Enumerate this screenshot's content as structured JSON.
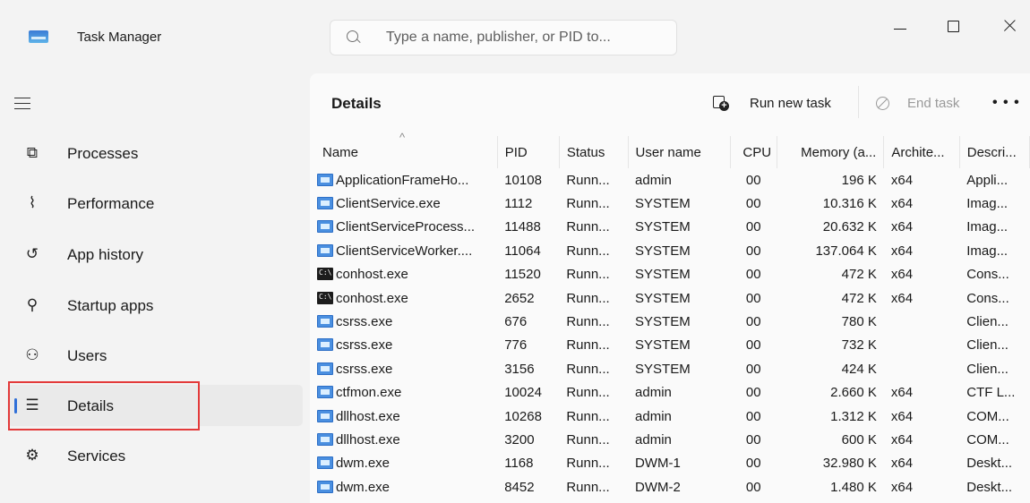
{
  "titlebar": {
    "app_title": "Task Manager",
    "search_placeholder": "Type a name, publisher, or PID to..."
  },
  "sidebar": {
    "items": [
      {
        "icon": "processes-icon",
        "label": "Processes"
      },
      {
        "icon": "performance-icon",
        "label": "Performance"
      },
      {
        "icon": "app-history-icon",
        "label": "App history"
      },
      {
        "icon": "startup-apps-icon",
        "label": "Startup apps"
      },
      {
        "icon": "users-icon",
        "label": "Users"
      },
      {
        "icon": "details-icon",
        "label": "Details",
        "selected": true
      },
      {
        "icon": "services-icon",
        "label": "Services"
      }
    ]
  },
  "main": {
    "title": "Details",
    "run_new_task": "Run new task",
    "end_task": "End task",
    "columns": [
      "Name",
      "PID",
      "Status",
      "User name",
      "CPU",
      "Memory (a...",
      "Archite...",
      "Descri..."
    ],
    "rows": [
      {
        "icon": "window",
        "name": "ApplicationFrameHo...",
        "pid": "10108",
        "status": "Runn...",
        "user": "admin",
        "cpu": "00",
        "mem": "196 K",
        "arch": "x64",
        "desc": "Appli..."
      },
      {
        "icon": "window",
        "name": "ClientService.exe",
        "pid": "1112",
        "status": "Runn...",
        "user": "SYSTEM",
        "cpu": "00",
        "mem": "10.316 K",
        "arch": "x64",
        "desc": "Imag..."
      },
      {
        "icon": "window",
        "name": "ClientServiceProcess...",
        "pid": "11488",
        "status": "Runn...",
        "user": "SYSTEM",
        "cpu": "00",
        "mem": "20.632 K",
        "arch": "x64",
        "desc": "Imag..."
      },
      {
        "icon": "window",
        "name": "ClientServiceWorker....",
        "pid": "11064",
        "status": "Runn...",
        "user": "SYSTEM",
        "cpu": "00",
        "mem": "137.064 K",
        "arch": "x64",
        "desc": "Imag..."
      },
      {
        "icon": "console",
        "name": "conhost.exe",
        "pid": "11520",
        "status": "Runn...",
        "user": "SYSTEM",
        "cpu": "00",
        "mem": "472 K",
        "arch": "x64",
        "desc": "Cons..."
      },
      {
        "icon": "console",
        "name": "conhost.exe",
        "pid": "2652",
        "status": "Runn...",
        "user": "SYSTEM",
        "cpu": "00",
        "mem": "472 K",
        "arch": "x64",
        "desc": "Cons..."
      },
      {
        "icon": "window",
        "name": "csrss.exe",
        "pid": "676",
        "status": "Runn...",
        "user": "SYSTEM",
        "cpu": "00",
        "mem": "780 K",
        "arch": "",
        "desc": "Clien..."
      },
      {
        "icon": "window",
        "name": "csrss.exe",
        "pid": "776",
        "status": "Runn...",
        "user": "SYSTEM",
        "cpu": "00",
        "mem": "732 K",
        "arch": "",
        "desc": "Clien..."
      },
      {
        "icon": "window",
        "name": "csrss.exe",
        "pid": "3156",
        "status": "Runn...",
        "user": "SYSTEM",
        "cpu": "00",
        "mem": "424 K",
        "arch": "",
        "desc": "Clien..."
      },
      {
        "icon": "window",
        "name": "ctfmon.exe",
        "pid": "10024",
        "status": "Runn...",
        "user": "admin",
        "cpu": "00",
        "mem": "2.660 K",
        "arch": "x64",
        "desc": "CTF L..."
      },
      {
        "icon": "window",
        "name": "dllhost.exe",
        "pid": "10268",
        "status": "Runn...",
        "user": "admin",
        "cpu": "00",
        "mem": "1.312 K",
        "arch": "x64",
        "desc": "COM..."
      },
      {
        "icon": "window",
        "name": "dllhost.exe",
        "pid": "3200",
        "status": "Runn...",
        "user": "admin",
        "cpu": "00",
        "mem": "600 K",
        "arch": "x64",
        "desc": "COM..."
      },
      {
        "icon": "window",
        "name": "dwm.exe",
        "pid": "1168",
        "status": "Runn...",
        "user": "DWM-1",
        "cpu": "00",
        "mem": "32.980 K",
        "arch": "x64",
        "desc": "Deskt..."
      },
      {
        "icon": "window",
        "name": "dwm.exe",
        "pid": "8452",
        "status": "Runn...",
        "user": "DWM-2",
        "cpu": "00",
        "mem": "1.480 K",
        "arch": "x64",
        "desc": "Deskt..."
      }
    ]
  },
  "colors": {
    "accent": "#2f6fd8",
    "highlight_box": "#e33a3a",
    "window_bg": "#f3f3f3",
    "panel_bg": "#fafafa"
  }
}
